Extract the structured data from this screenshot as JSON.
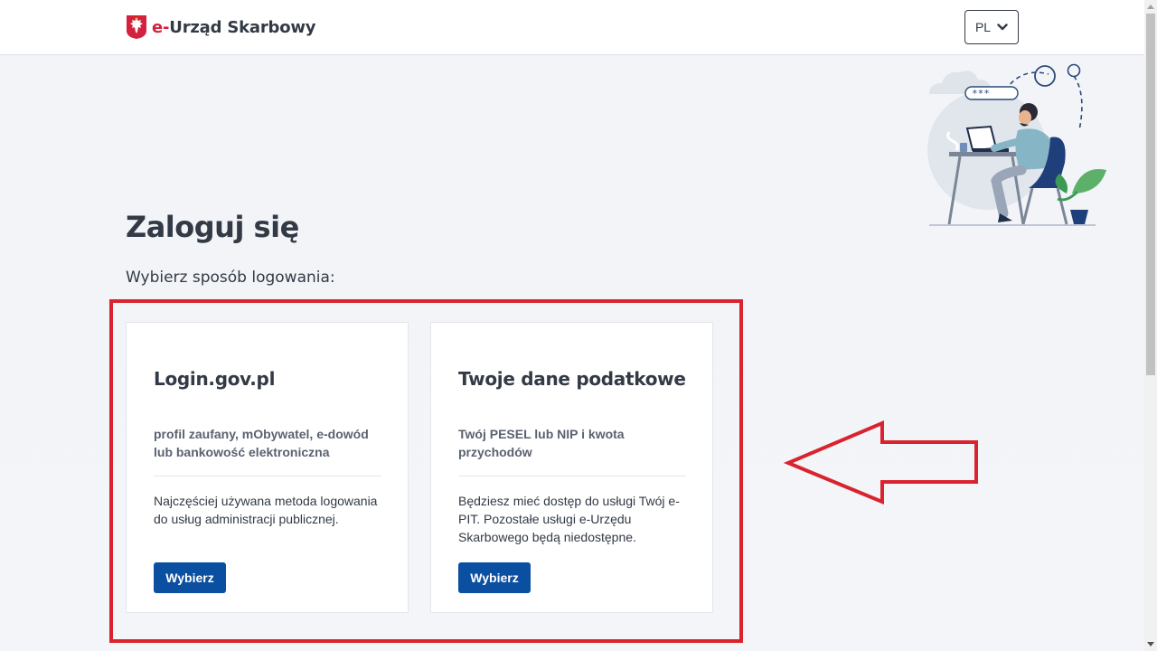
{
  "header": {
    "brand_prefix": "e-",
    "brand_name": "Urząd Skarbowy",
    "language": "PL"
  },
  "main": {
    "title": "Zaloguj się",
    "subtitle": "Wybierz sposób logowania:",
    "cards": [
      {
        "title": "Login.gov.pl",
        "subtitle": "profil zaufany, mObywatel, e-dowód lub bankowość elektroniczna",
        "description": "Najczęściej używana metoda logowania do usług administracji publicznej.",
        "button_label": "Wybierz"
      },
      {
        "title": "Twoje dane podatkowe",
        "subtitle": "Twój PESEL lub NIP i kwota przychodów",
        "description": "Będziesz mieć dostęp do usługi Twój e-PIT. Pozostałe usługi e-Urzędu Skarbowego będą niedostępne.",
        "button_label": "Wybierz"
      }
    ]
  },
  "illustration": {
    "password_mask": "***"
  },
  "colors": {
    "brand_red": "#d4213d",
    "primary_blue": "#0b4fa1",
    "annotation_red": "#d9232e",
    "text_dark": "#323a45"
  },
  "icons": [
    "eagle-emblem-icon",
    "chevron-down-icon",
    "arrow-left-annotation-icon"
  ]
}
